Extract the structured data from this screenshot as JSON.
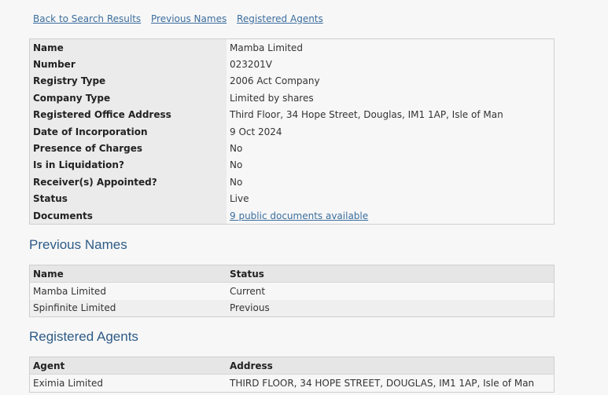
{
  "nav": {
    "links": [
      "Back to Search Results",
      "Previous Names",
      "Registered Agents"
    ]
  },
  "details": [
    {
      "label": "Name",
      "value": "Mamba Limited"
    },
    {
      "label": "Number",
      "value": "023201V"
    },
    {
      "label": "Registry Type",
      "value": "2006 Act Company"
    },
    {
      "label": "Company Type",
      "value": "Limited by shares"
    },
    {
      "label": "Registered Office Address",
      "value": "Third Floor, 34 Hope Street, Douglas, IM1 1AP, Isle of Man"
    },
    {
      "label": "Date of Incorporation",
      "value": "9 Oct 2024"
    },
    {
      "label": "Presence of Charges",
      "value": "No"
    },
    {
      "label": "Is in Liquidation?",
      "value": "No"
    },
    {
      "label": "Receiver(s) Appointed?",
      "value": "No"
    },
    {
      "label": "Status",
      "value": "Live"
    },
    {
      "label": "Documents",
      "value": "9 public documents available"
    }
  ],
  "previous_names": {
    "heading": "Previous Names",
    "columns": [
      "Name",
      "Status"
    ],
    "rows": [
      [
        "Mamba Limited",
        "Current"
      ],
      [
        "Spinfinite Limited",
        "Previous"
      ]
    ]
  },
  "registered_agents": {
    "heading": "Registered Agents",
    "columns": [
      "Agent",
      "Address"
    ],
    "rows": [
      [
        "Eximia Limited",
        "THIRD FLOOR, 34 HOPE STREET, DOUGLAS, IM1 1AP, Isle of Man"
      ]
    ]
  },
  "colors": {
    "link": "#3c6e9e",
    "heading": "#2d5b87",
    "label_bg": "#ebebeb",
    "page_bg": "#f7f7f7"
  }
}
